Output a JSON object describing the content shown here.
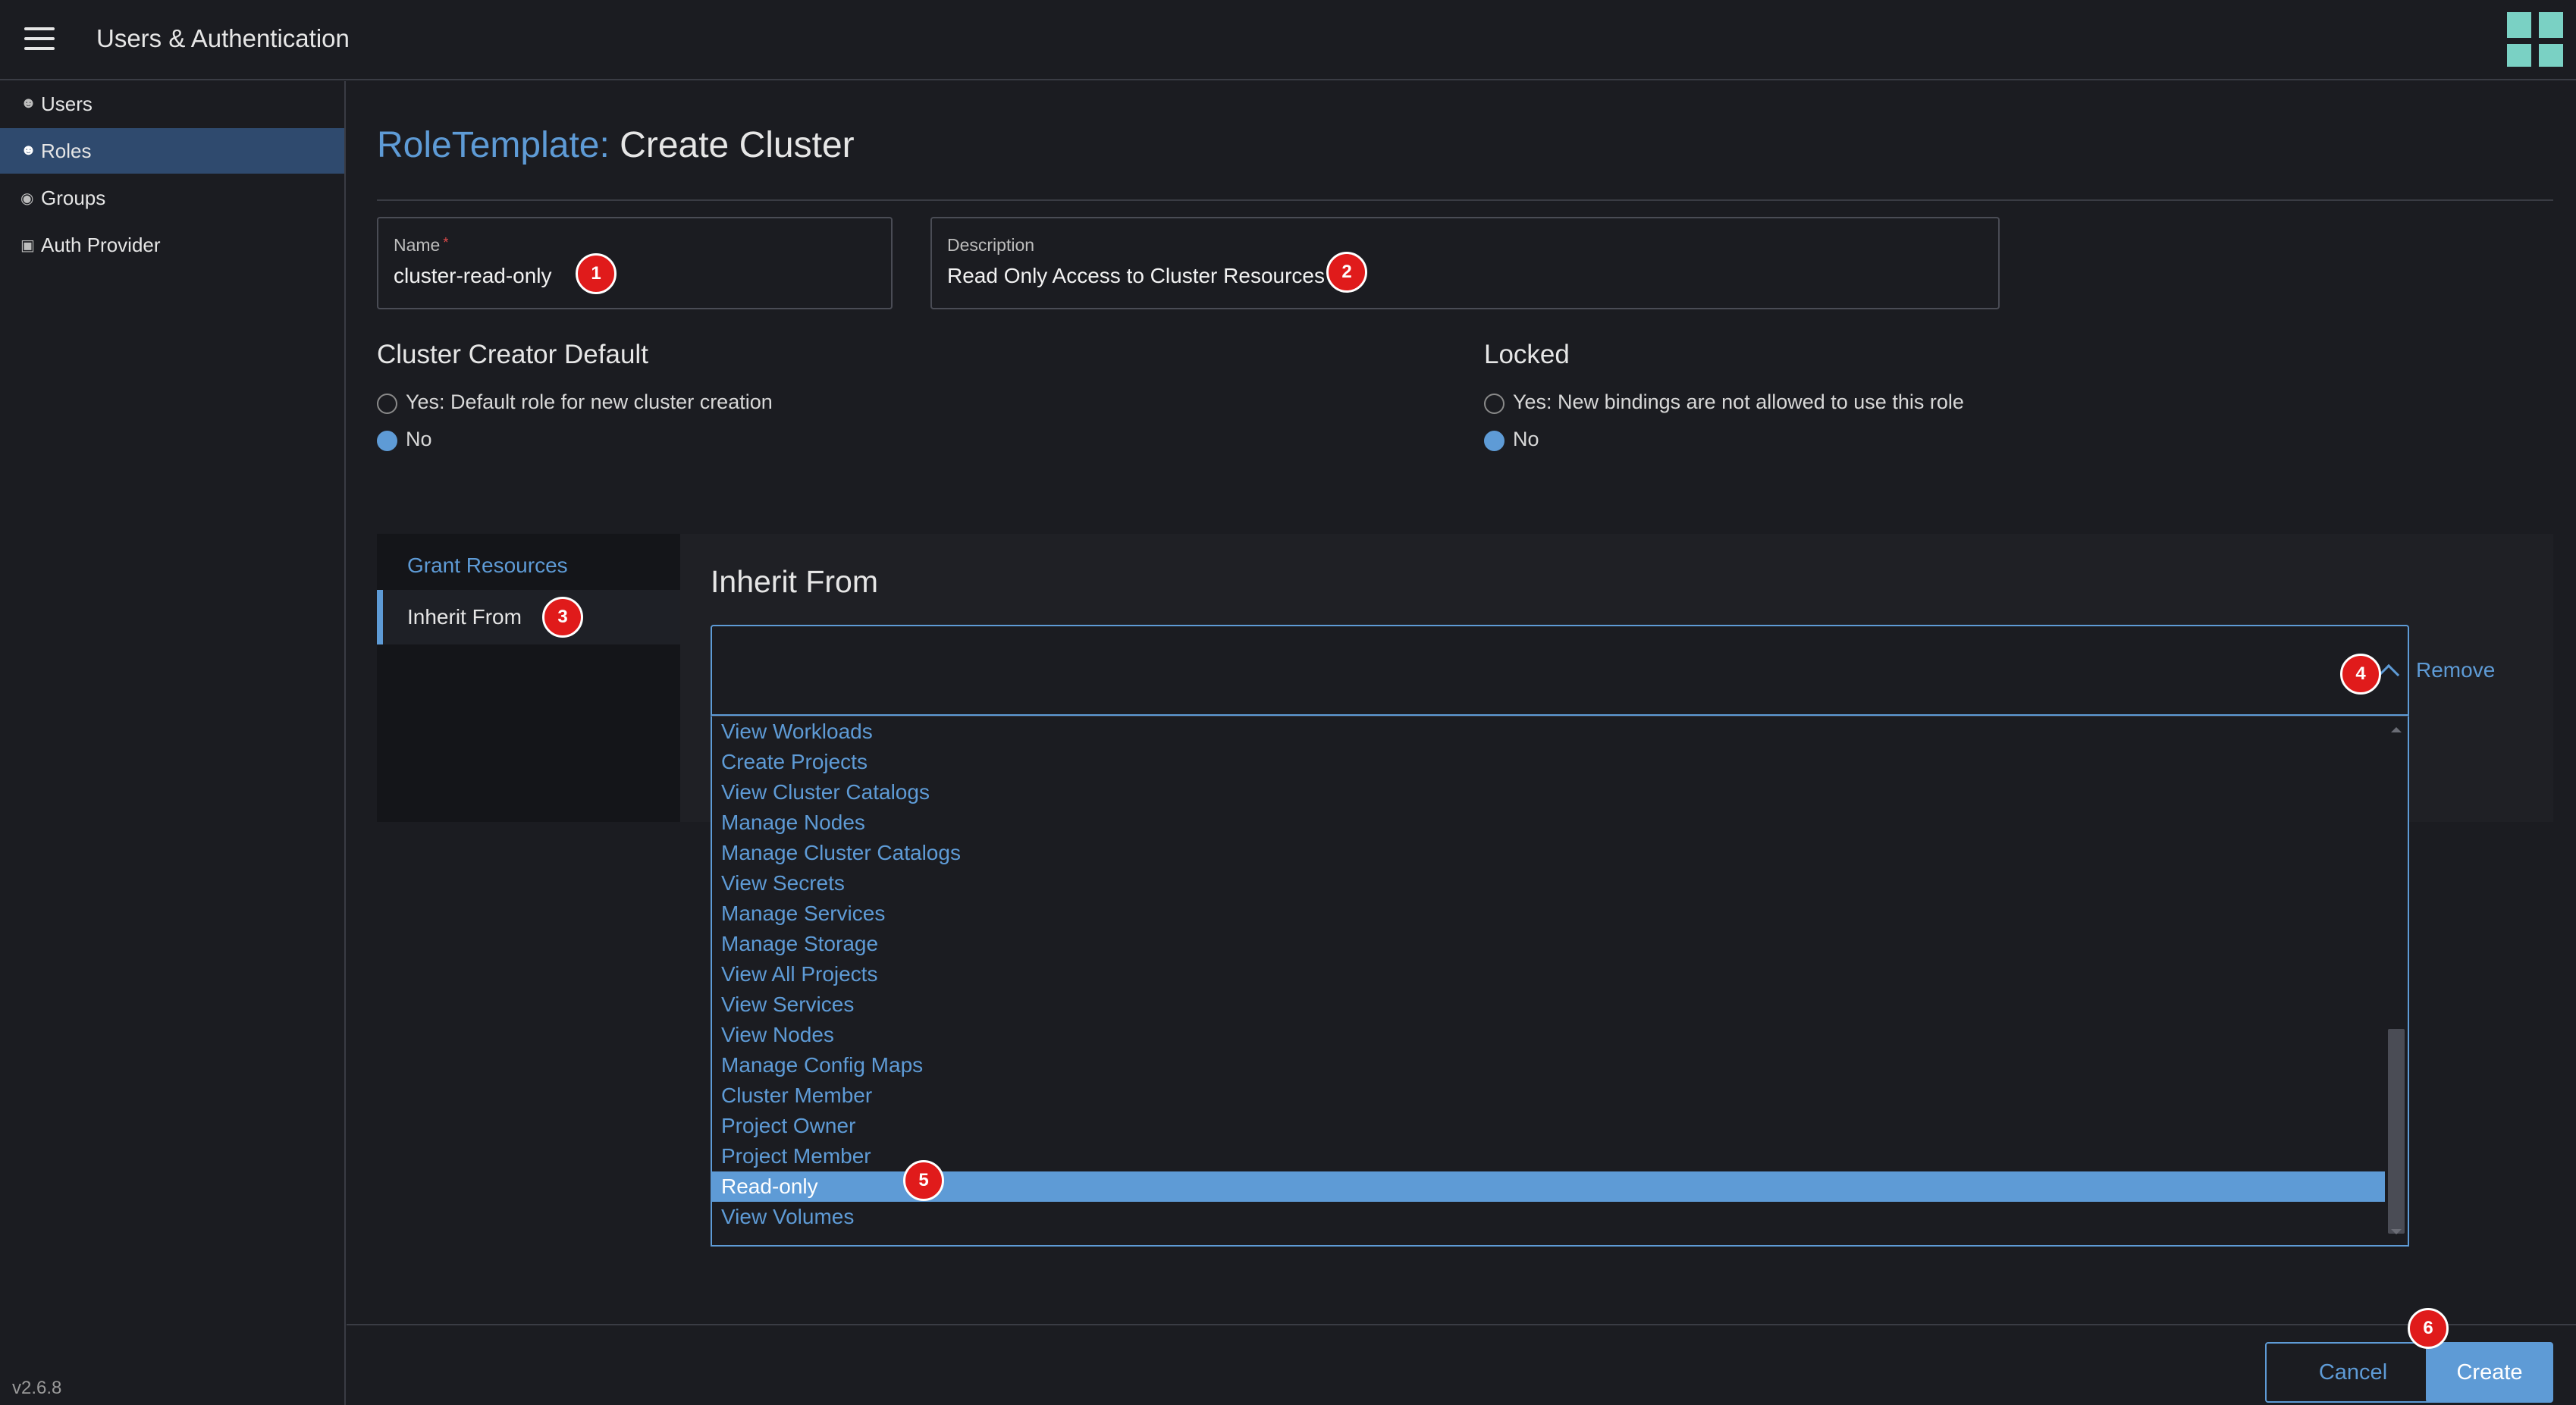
{
  "header": {
    "title": "Users & Authentication"
  },
  "sidebar": {
    "items": [
      {
        "label": "Users",
        "icon": "user-icon"
      },
      {
        "label": "Roles",
        "icon": "user-icon"
      },
      {
        "label": "Groups",
        "icon": "globe-icon"
      },
      {
        "label": "Auth Provider",
        "icon": "lock-icon"
      }
    ],
    "version": "v2.6.8"
  },
  "page": {
    "kind": "RoleTemplate:",
    "title": "Create Cluster"
  },
  "form": {
    "name_label": "Name",
    "name_required": "*",
    "name_value": "cluster-read-only",
    "description_label": "Description",
    "description_value": "Read Only Access to Cluster Resources"
  },
  "cluster_creator_default": {
    "heading": "Cluster Creator Default",
    "yes_label": "Yes: Default role for new cluster creation",
    "no_label": "No",
    "selected": "No"
  },
  "locked": {
    "heading": "Locked",
    "yes_label": "Yes: New bindings are not allowed to use this role",
    "no_label": "No",
    "selected": "No"
  },
  "tabs": {
    "grant": "Grant Resources",
    "inherit": "Inherit From"
  },
  "inherit": {
    "heading": "Inherit From",
    "remove_label": "Remove",
    "options": [
      "View Workloads",
      "Create Projects",
      "View Cluster Catalogs",
      "Manage Nodes",
      "Manage Cluster Catalogs",
      "View Secrets",
      "Manage Services",
      "Manage Storage",
      "View All Projects",
      "View Services",
      "View Nodes",
      "Manage Config Maps",
      "Cluster Member",
      "Project Owner",
      "Project Member",
      "Read-only",
      "View Volumes"
    ],
    "selected": "Read-only"
  },
  "footer": {
    "cancel_label": "Cancel",
    "create_label": "Create"
  },
  "annotations": {
    "b1": "1",
    "b2": "2",
    "b3": "3",
    "b4": "4",
    "b5": "5",
    "b6": "6"
  },
  "colors": {
    "accent": "#5e9bd6",
    "badge": "#e01b1b",
    "background": "#1b1c21",
    "brand": "#7ad1c4"
  }
}
